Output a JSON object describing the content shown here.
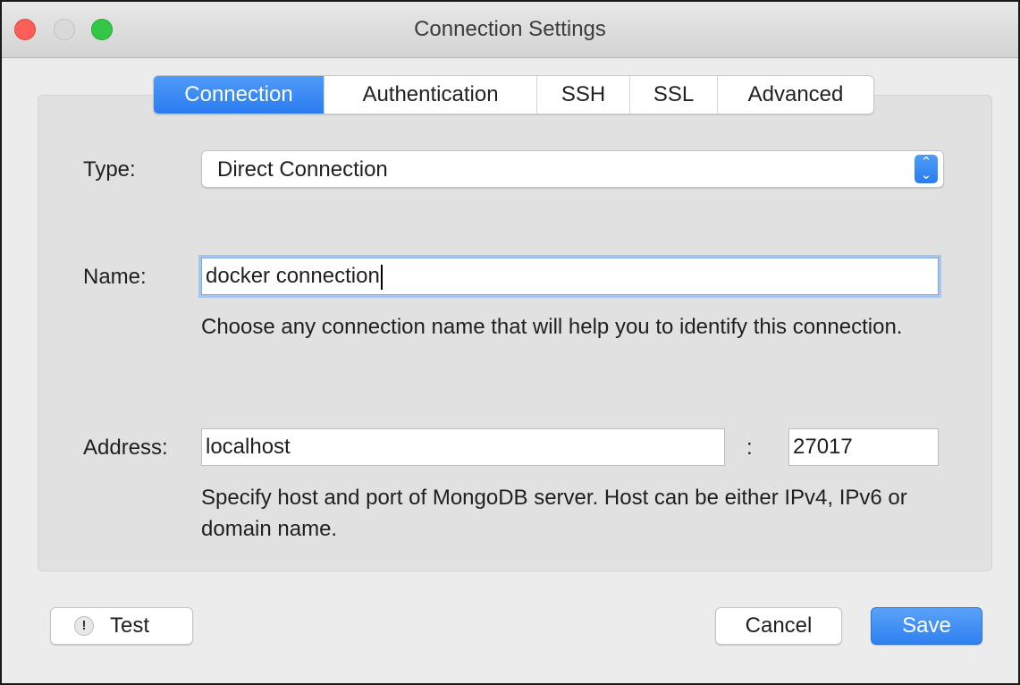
{
  "window": {
    "title": "Connection Settings"
  },
  "tabs": [
    {
      "label": "Connection",
      "active": true
    },
    {
      "label": "Authentication",
      "active": false
    },
    {
      "label": "SSH",
      "active": false
    },
    {
      "label": "SSL",
      "active": false
    },
    {
      "label": "Advanced",
      "active": false
    }
  ],
  "form": {
    "type_label": "Type:",
    "type_value": "Direct Connection",
    "name_label": "Name:",
    "name_value": "docker connection",
    "name_help": "Choose any connection name that will help you to identify this connection.",
    "address_label": "Address:",
    "host_value": "localhost",
    "separator": ":",
    "port_value": "27017",
    "address_help": "Specify host and port of MongoDB server. Host can be either IPv4, IPv6 or domain name."
  },
  "buttons": {
    "test_label": "Test",
    "test_icon": "!",
    "cancel_label": "Cancel",
    "save_label": "Save"
  },
  "colors": {
    "accent": "#2f80f1",
    "close": "#fc5f57",
    "maximize": "#33c748"
  },
  "icons": {
    "select_arrows": "updown-chevron-icon",
    "test": "exclamation-icon"
  }
}
